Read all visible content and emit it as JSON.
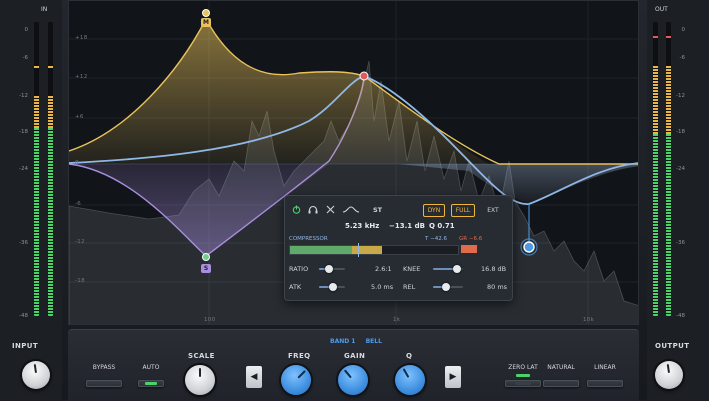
{
  "meters": {
    "in": {
      "title": "IN",
      "scale": [
        "0",
        "-6",
        "-12",
        "-18",
        "-24",
        "-36",
        "-48"
      ],
      "level_l": 0.82,
      "level_r": 0.82
    },
    "out": {
      "title": "OUT",
      "scale": [
        "0",
        "-6",
        "-12",
        "-18",
        "-24",
        "-36",
        "-48"
      ],
      "level_l": 0.86,
      "level_r": 0.86
    }
  },
  "knobs": {
    "input": "INPUT",
    "output": "OUTPUT"
  },
  "graph": {
    "db_scale": [
      "+18",
      "+12",
      "+6",
      "0",
      "-6",
      "-12",
      "-18"
    ],
    "freq_labels": [
      "100",
      "1k",
      "10k"
    ],
    "band_markers": {
      "m": "M",
      "s": "S"
    }
  },
  "popup": {
    "readout": {
      "freq": "5.23 kHz",
      "gain": "−13.1 dB",
      "q": "Q 0.71"
    },
    "st_label": "ST",
    "modes": [
      "DYN",
      "FULL",
      "EXT"
    ],
    "compressor_label": "COMPRESSOR",
    "threshold": "T −42.6",
    "gr": "GR −6.6",
    "ratio": {
      "label": "RATIO",
      "value": "2.6:1"
    },
    "knee": {
      "label": "KNEE",
      "value": "16.8 dB"
    },
    "atk": {
      "label": "ATK",
      "value": "5.0 ms"
    },
    "rel": {
      "label": "REL",
      "value": "80 ms"
    }
  },
  "panel": {
    "band_title": "BAND 1",
    "band_type": "BELL",
    "bypass": "BYPASS",
    "auto": "AUTO",
    "scale": "SCALE",
    "freq": "FREQ",
    "gain": "GAIN",
    "q": "Q",
    "zero_lat": "ZERO LAT",
    "natural": "NATURAL",
    "linear": "LINEAR"
  },
  "colors": {
    "accent": "#4d9be8",
    "band_m": "#e9c25a",
    "band_s": "#a98ee0",
    "led": "#4bd36a",
    "peak": "#e25a5a"
  }
}
